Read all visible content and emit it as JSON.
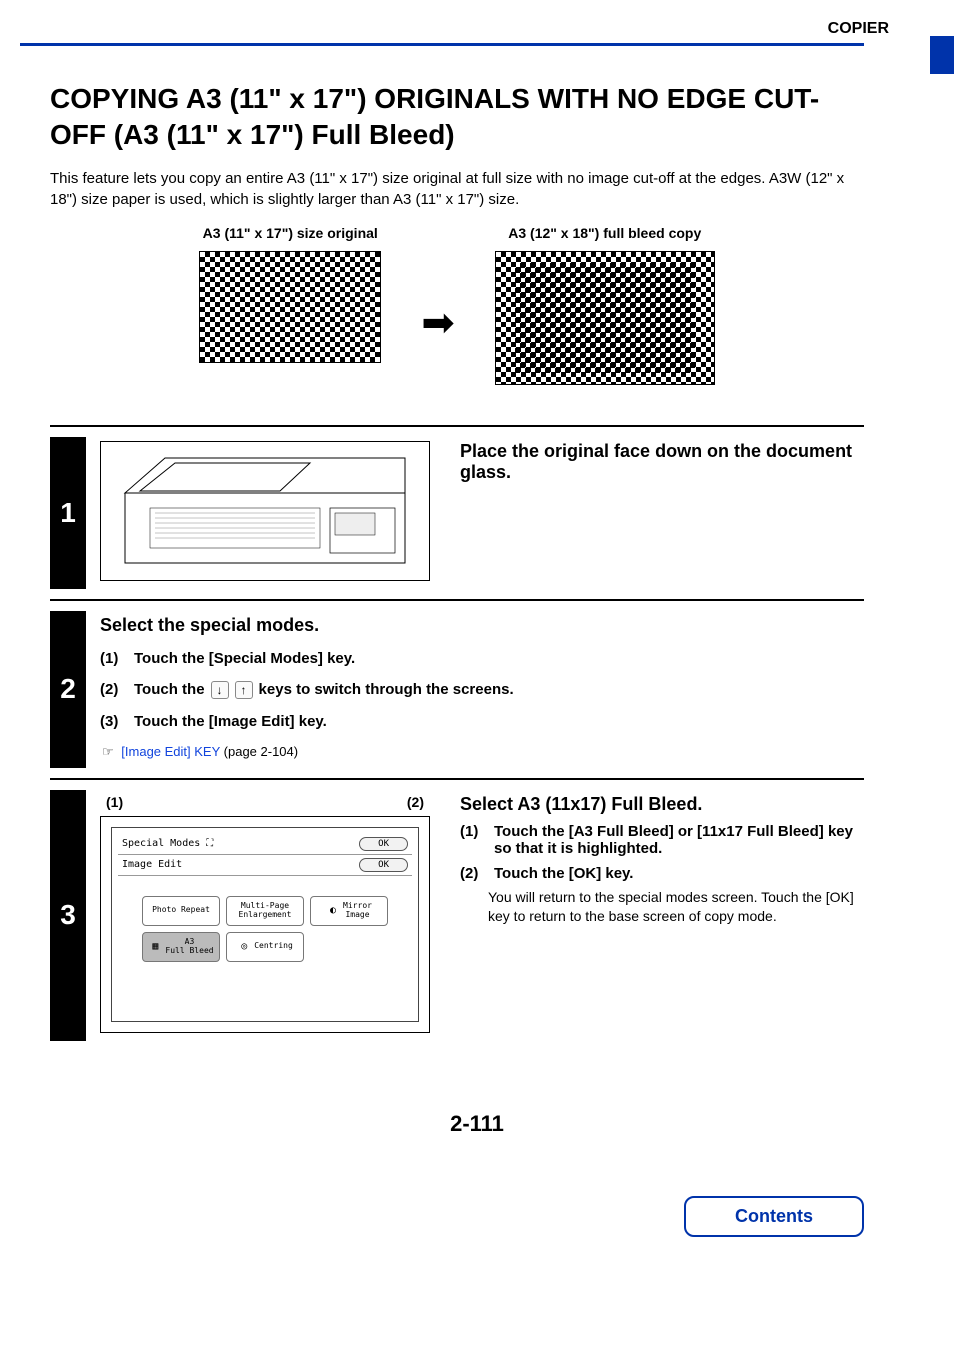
{
  "header": {
    "section": "COPIER"
  },
  "title": "COPYING A3 (11\" x 17\") ORIGINALS WITH NO EDGE CUT-OFF (A3 (11\" x 17\") Full Bleed)",
  "intro": "This feature lets you copy an entire A3 (11\" x 17\") size original at full size with no image cut-off at the edges. A3W (12\" x 18\") size paper is used, which is slightly larger than A3 (11\" x 17\") size.",
  "diagram": {
    "left_label": "A3 (11\" x 17\") size original",
    "right_label": "A3 (12\" x 18\") full bleed copy"
  },
  "steps": {
    "s1": {
      "num": "1",
      "heading": "Place the original face down on the document glass."
    },
    "s2": {
      "num": "2",
      "heading": "Select the special modes.",
      "sub1_num": "(1)",
      "sub1": "Touch the [Special Modes] key.",
      "sub2_num": "(2)",
      "sub2a": "Touch the",
      "sub2b": "keys to switch through the screens.",
      "sub3_num": "(3)",
      "sub3": "Touch the [Image Edit] key.",
      "ref_link": "[Image Edit] KEY",
      "ref_page": " (page 2-104)"
    },
    "s3": {
      "num": "3",
      "heading": "Select A3 (11x17) Full Bleed.",
      "sub1_num": "(1)",
      "sub1": "Touch the [A3 Full Bleed] or [11x17 Full Bleed] key so that it is highlighted.",
      "sub2_num": "(2)",
      "sub2": "Touch the [OK] key.",
      "sub2_desc": "You will return to the special modes screen. Touch the [OK] key to return to the base screen of copy mode.",
      "callout1": "(1)",
      "callout2": "(2)",
      "panel": {
        "row1_label": "Special Modes",
        "row2_label": "Image Edit",
        "ok": "OK",
        "btn_photo": "Photo Repeat",
        "btn_multi": "Multi-Page\nEnlargement",
        "btn_mirror": "Mirror\nImage",
        "btn_a3": "A3\nFull Bleed",
        "btn_centring": "Centring"
      }
    }
  },
  "page_number": "2-111",
  "contents_label": "Contents"
}
